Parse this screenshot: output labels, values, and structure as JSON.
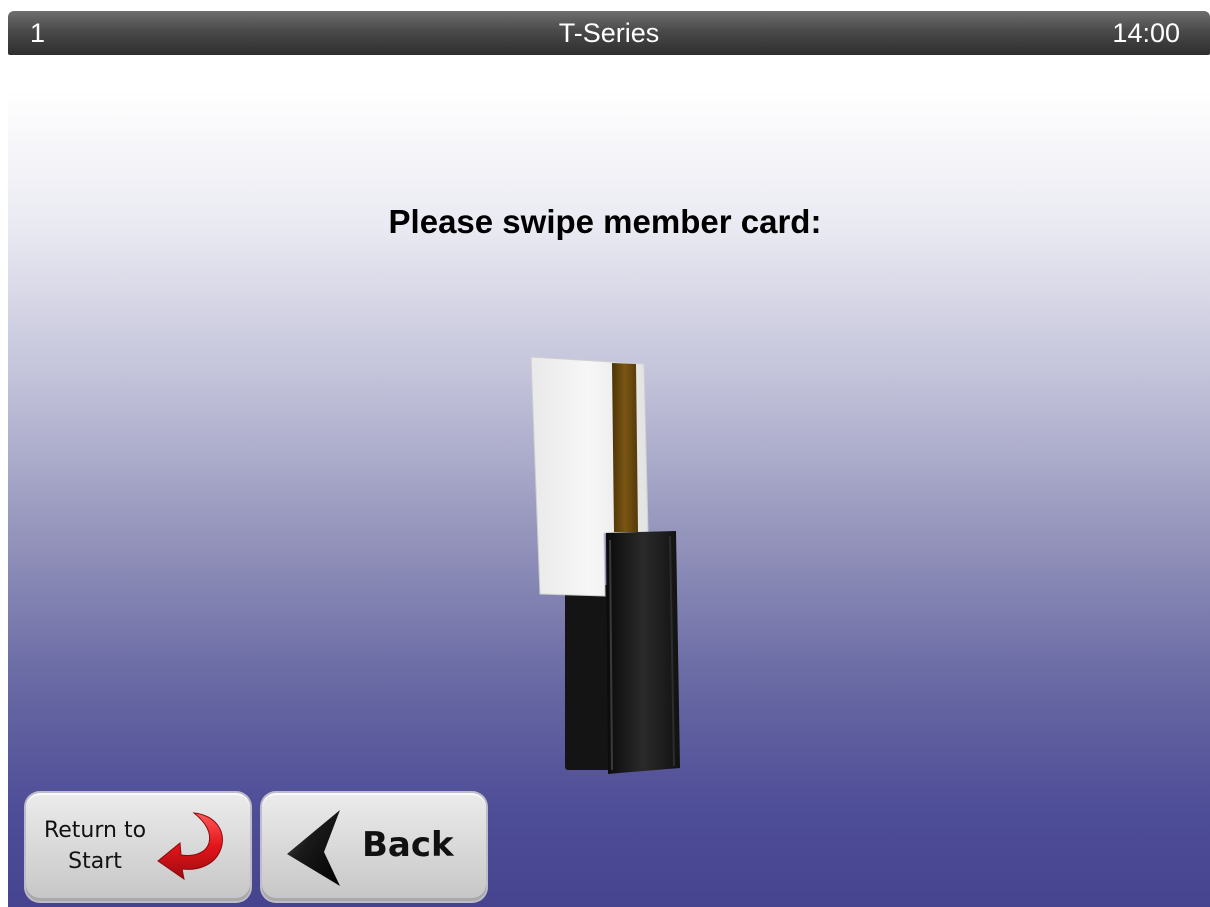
{
  "status_bar": {
    "terminal_number": "1",
    "title": "T-Series",
    "time": "14:00"
  },
  "main": {
    "prompt": "Please swipe member card:",
    "illustration": "card-reader-icon"
  },
  "buttons": {
    "return_to_start": {
      "line1": "Return to",
      "line2": "Start",
      "icon": "return-arrow-icon"
    },
    "back": {
      "label": "Back",
      "icon": "back-arrow-icon"
    }
  },
  "colors": {
    "top_bar": "#4a4a4a",
    "gradient_top": "#ffffff",
    "gradient_bottom": "#47448f",
    "return_arrow": "#e0161b",
    "magnetic_stripe": "#6b4a10"
  }
}
